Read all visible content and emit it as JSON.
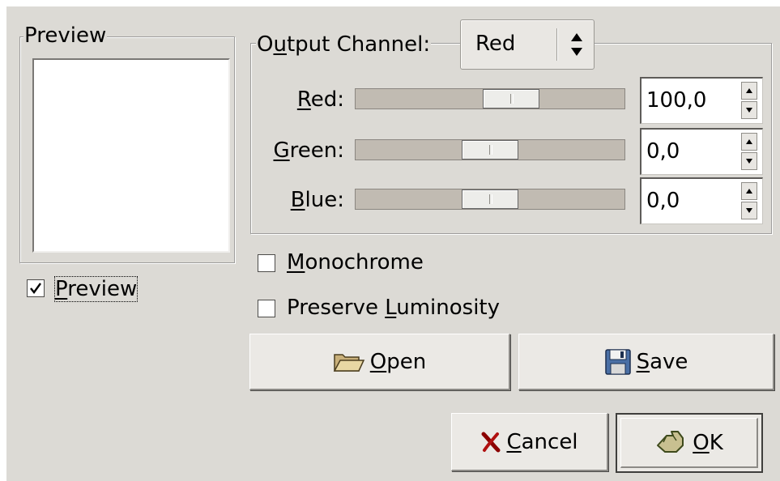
{
  "preview_frame": {
    "title": "Preview"
  },
  "preview_toggle": {
    "label_pre": "",
    "label_u": "P",
    "label_post": "review",
    "checked": true
  },
  "output_channel": {
    "label_pre": "O",
    "label_u": "u",
    "label_post": "tput Channel:",
    "selected": "Red"
  },
  "channels": [
    {
      "key": "red",
      "label_u": "R",
      "label_post": "ed:",
      "value": "100,0",
      "slider_fraction": 0.6
    },
    {
      "key": "green",
      "label_u": "G",
      "label_post": "reen:",
      "value": "0,0",
      "slider_fraction": 0.5
    },
    {
      "key": "blue",
      "label_u": "B",
      "label_post": "lue:",
      "value": "0,0",
      "slider_fraction": 0.5
    }
  ],
  "options": {
    "monochrome": {
      "label_pre": "",
      "label_u": "M",
      "label_post": "onochrome",
      "checked": false
    },
    "preserve": {
      "label_pre": "Preserve ",
      "label_u": "L",
      "label_post": "uminosity",
      "checked": false
    }
  },
  "buttons": {
    "open": {
      "label_u": "O",
      "label_post": "pen",
      "icon": "folder-open-icon"
    },
    "save": {
      "label_u": "S",
      "label_post": "ave",
      "icon": "floppy-disk-icon"
    },
    "cancel": {
      "label_u": "C",
      "label_post": "ancel",
      "icon": "cancel-x-icon"
    },
    "ok": {
      "label_u": "O",
      "label_post": "K",
      "icon": "ok-hand-icon"
    }
  }
}
